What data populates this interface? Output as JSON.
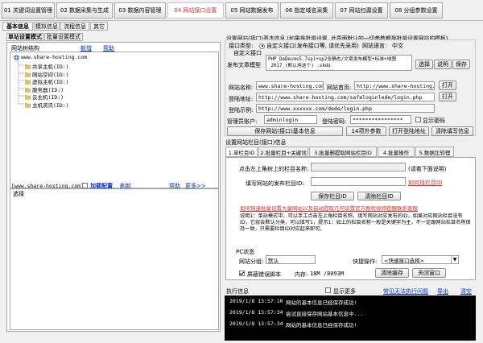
{
  "top_tabs": [
    {
      "label": "01 关键词设置管理"
    },
    {
      "label": "02 数据采集与生成"
    },
    {
      "label": "03 数据内容管理"
    },
    {
      "label": "04 网站接口设置"
    },
    {
      "label": "05 网站数据发布"
    },
    {
      "label": "06 指定域名采集"
    },
    {
      "label": "07 网站扫漏设置"
    },
    {
      "label": "08 分组参数设置"
    }
  ],
  "sub_tabs": [
    {
      "label": "基本信息"
    },
    {
      "label": "模拟信息"
    },
    {
      "label": "流程信息"
    },
    {
      "label": "其它"
    }
  ],
  "left": {
    "tabs": [
      {
        "label": "单站设置模式"
      },
      {
        "label": "批量设置模式"
      }
    ],
    "tree_title": "网站树结构",
    "tree_new": "新增",
    "tree_help": "帮助",
    "tree_root": "www.share-hosting.com",
    "tree_children": [
      "共享主机(ID:)",
      "网站空间(ID:)",
      "虚拟主机(ID:)",
      "服务器(ID:)",
      "云主机(ID:)",
      "主机资讯(ID:)"
    ],
    "bottom_input": "[www.share-hosting.com]",
    "load_config": "加载配置",
    "refresh": "刷新",
    "help": "帮助",
    "more": "更多>>",
    "select_button": "选择"
  },
  "right": {
    "header": "设置网站(接口)基本信息 (如果是批量设置, 此界面默认的一切参数都是批量设置网站的模板)",
    "interface_type_label": "接口类型:",
    "interface_type_option1": "自定义接口(发布接口等, 请优先采用)",
    "interface_type_option2": "自定义接口",
    "site_lang_label": "网站语言:",
    "site_lang_value": "中文",
    "publish_model_label": "发布文章模型",
    "publish_model_value": "PHP_DeDecms5.7sp1+sp2全静态/文章发布模型+标准+地图_2017_(默认用这个) .skds",
    "select_btn": "选择",
    "explain_btn": "说明",
    "save_btn": "保存",
    "site_name_label": "网站名称:",
    "site_name_value": "www.share-hosting.com",
    "site_home_label": "网站首页:",
    "site_home_value": "http://www.share-hosting.com",
    "open_btn": "打开",
    "login_url_label": "登陆地址:",
    "login_url_value": "http://www.share-hosting.com/safeloginlede/login.php",
    "login_example_label": "登陆示例:",
    "login_example_value": "http://www.xxxxxx.com/dede/login.php",
    "admin_user_label": "管理员账户:",
    "admin_user_value": "adminlogin",
    "login_pass_label": "登陆密码:",
    "login_pass_value": "****************",
    "show_pass_label": "显示密码",
    "save_basic_btn": "保存网站(接口)基本信息",
    "params_btn": "14项外参数",
    "open_login_btn": "打开登陆地址",
    "clear_btn": "清除填写信息",
    "column_section_title": "设置网站栏目(接口)信息",
    "inner_tabs": [
      {
        "label": "1.单栏目ID"
      },
      {
        "label": "2.批量栏目+关键词"
      },
      {
        "label": "3.批量删提取网站栏目ID"
      },
      {
        "label": "4.批量操作"
      },
      {
        "label": "5.数据比较理"
      }
    ],
    "col_name_label": "点击左上角树上的栏目名称:",
    "col_name_hint": "(请看下面说明)",
    "col_id_label": "填写网站的发布栏目ID:",
    "col_id_link": "如何找栏目ID",
    "save_col_btn": "保存栏目ID",
    "clear_col_btn": "清除栏目ID",
    "warning_link": "如何快速批量设置大量网站以及自动提取几何设置官方教程视频提醒联系客服",
    "note_text": "说明1：单站模式中，可以手工点击左上角栏目名称，填写网站对应发布的ID，如果对应网站栏目没有ID，它就会默认分类，可以填写1，提示1：如上的栏目名称一般是关键字为主，不一定跟网站栏目名称保持一致，只需要栏目ID对应起来即可。",
    "pc_status_label": "PC状态",
    "site_group_label": "网站分组:",
    "site_group_value": "默认",
    "quick_op_label": "快捷操作:",
    "quick_op_value": "<快速窗口选择>",
    "screen_script_label": "屏蔽错误脚本",
    "memory_label": "内存:",
    "memory_value": "18M /8093M",
    "clear_cache_btn": "清除缓存",
    "close_window_btn": "关闭窗口"
  },
  "log": {
    "title": "执行信息",
    "show_more": "显示更多",
    "link1": "常见无法执行问题",
    "link2": "导出",
    "link3": "清空",
    "rows": [
      {
        "time": "2019/1/8 13:57:10",
        "msg": "网站的基本信息已经保存成功!"
      },
      {
        "time": "2019/1/8 13:57:34",
        "msg": "尝试直接保存网站基本信息中..."
      },
      {
        "time": "2019/1/8 13:57:34",
        "msg": "网站的基本信息已经保存成功!"
      }
    ]
  }
}
